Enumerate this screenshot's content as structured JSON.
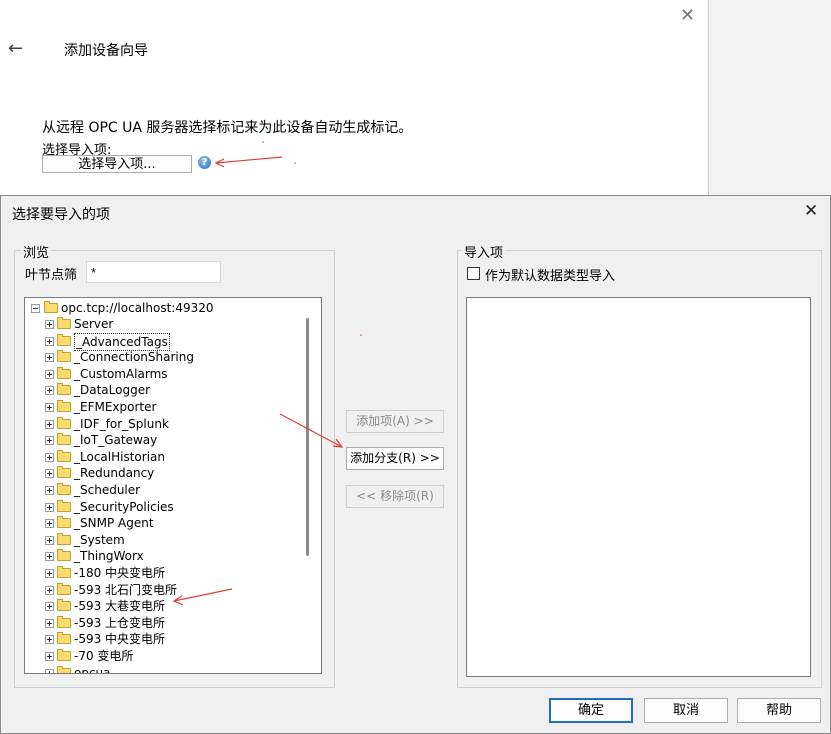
{
  "wizard": {
    "title": "添加设备向导",
    "description": "从远程 OPC UA 服务器选择标记来为此设备自动生成标记。",
    "select_label": "选择导入项:",
    "select_button": "选择导入项..."
  },
  "dialog": {
    "title": "选择要导入的项",
    "browse_group": "浏览",
    "filter_label": "叶节点筛",
    "filter_value": "*",
    "root": "opc.tcp://localhost:49320",
    "tree_items": [
      "Server",
      "_AdvancedTags",
      "_ConnectionSharing",
      "_CustomAlarms",
      "_DataLogger",
      "_EFMExporter",
      "_IDF_for_Splunk",
      "_IoT_Gateway",
      "_LocalHistorian",
      "_Redundancy",
      "_Scheduler",
      "_SecurityPolicies",
      "_SNMP Agent",
      "_System",
      "_ThingWorx",
      "-180 中央变电所",
      "-593 北石门变电所",
      "-593 大巷变电所",
      "-593 上仓变电所",
      "-593 中央变电所",
      "-70 变电所",
      "opcua"
    ],
    "add_item_button": "添加项(A) >>",
    "add_branch_button": "添加分支(R) >>",
    "remove_item_button": "<< 移除项(R)",
    "import_group": "导入项",
    "default_type_checkbox": "作为默认数据类型导入",
    "ok_button": "确定",
    "cancel_button": "取消",
    "help_button": "帮助"
  },
  "colors": {
    "annotation_arrow": "#e03c3c",
    "focus_border": "#1f6fbf",
    "folder_fill": "#f8dc6b"
  }
}
